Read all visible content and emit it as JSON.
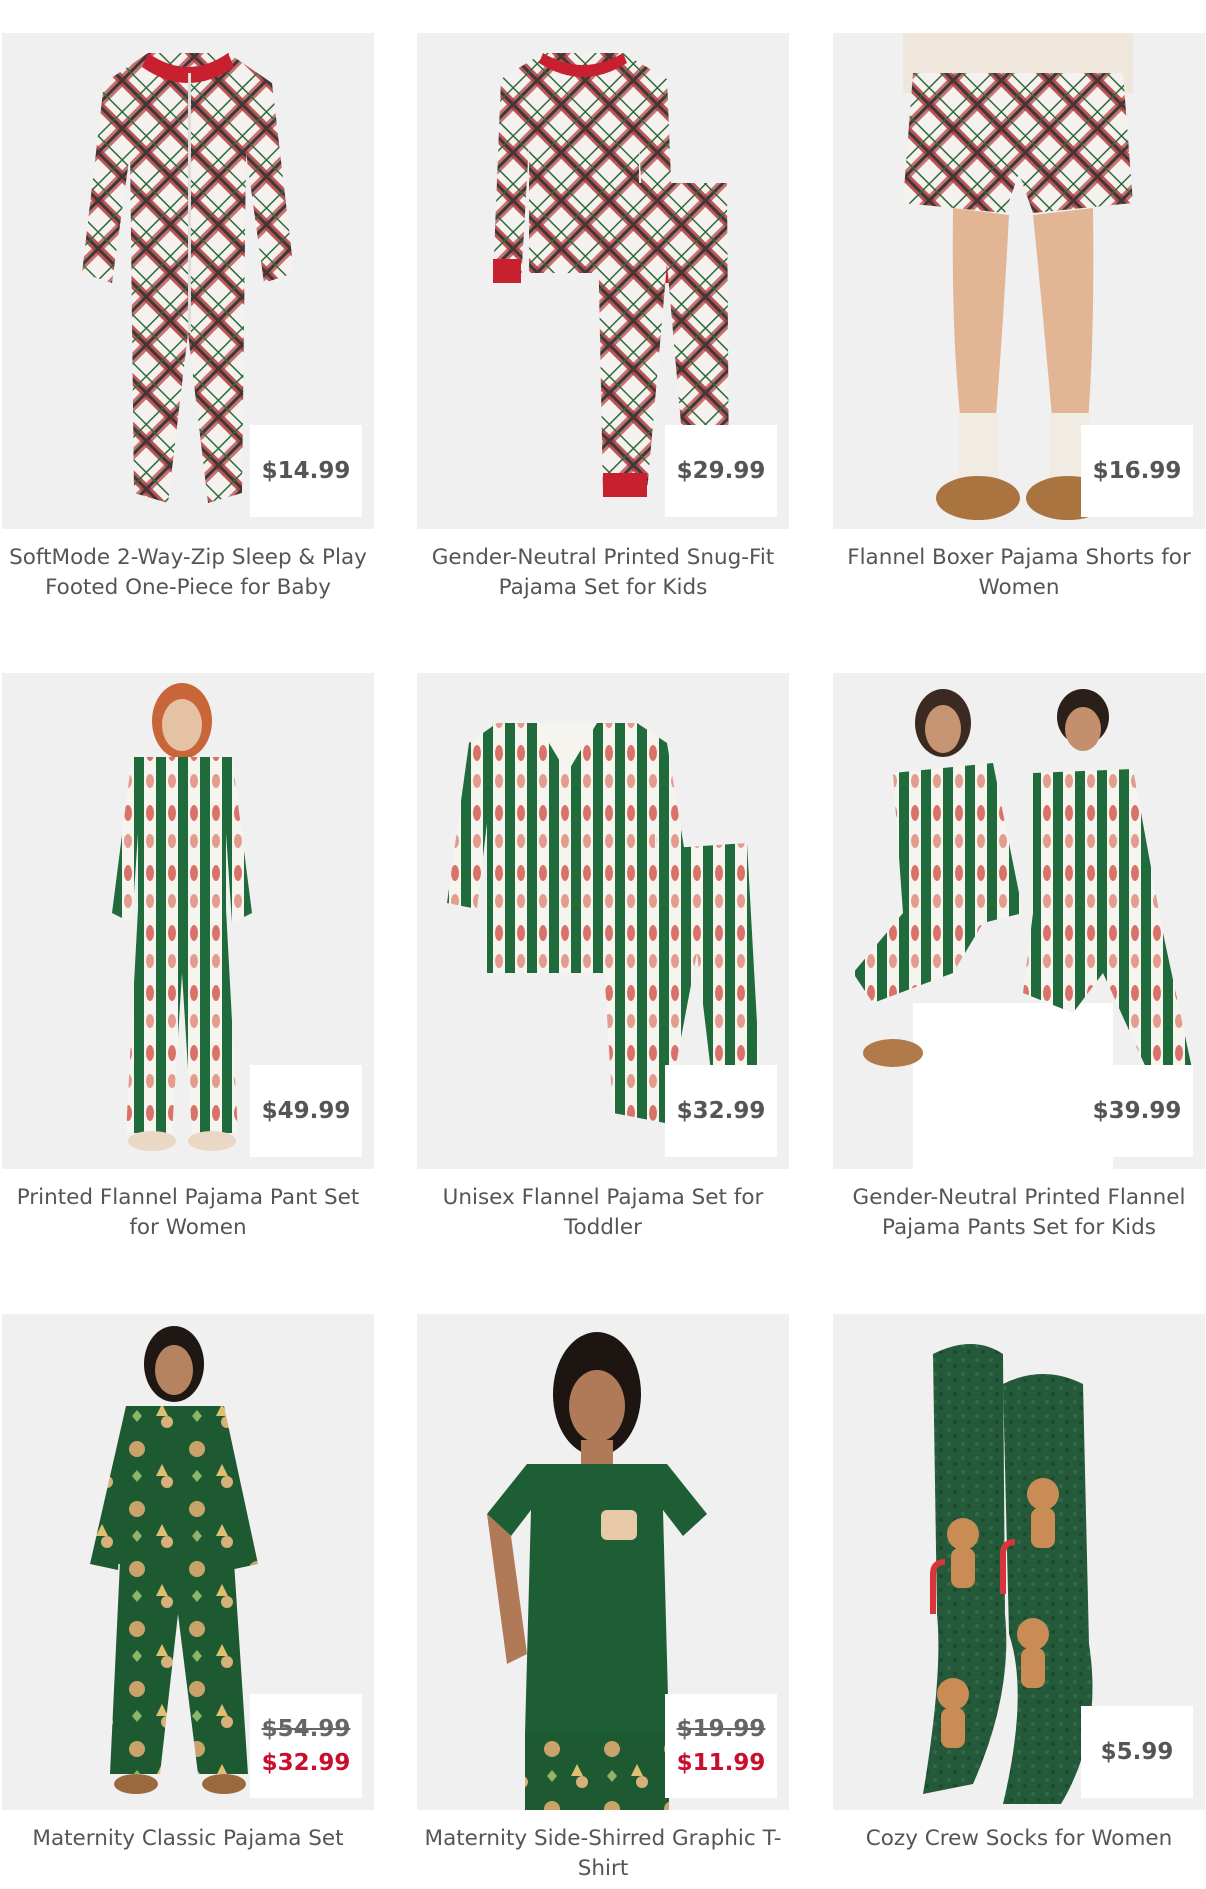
{
  "products": [
    {
      "title": "SoftMode 2-Way-Zip Sleep & Play Footed One-Piece for Baby",
      "price": "$14.99"
    },
    {
      "title": "Gender-Neutral Printed Snug-Fit Pajama Set for Kids",
      "price": "$29.99"
    },
    {
      "title": "Flannel Boxer Pajama Shorts for Women",
      "price": "$16.99"
    },
    {
      "title": "Printed Flannel Pajama Pant Set for Women",
      "price": "$49.99"
    },
    {
      "title": "Unisex Flannel Pajama Set for Toddler",
      "price": "$32.99"
    },
    {
      "title": "Gender-Neutral Printed Flannel Pajama Pants Set for Kids",
      "price": "$39.99"
    },
    {
      "title": "Maternity Classic Pajama Set",
      "original_price": "$54.99",
      "sale_price": "$32.99"
    },
    {
      "title": "Maternity Side-Shirred Graphic T-Shirt",
      "original_price": "$19.99",
      "sale_price": "$11.99"
    },
    {
      "title": "Cozy Crew Socks for Women",
      "price": "$5.99"
    }
  ],
  "colors": {
    "sale": "#c8102e",
    "text": "#555555",
    "image_bg": "#f0f0f0"
  }
}
